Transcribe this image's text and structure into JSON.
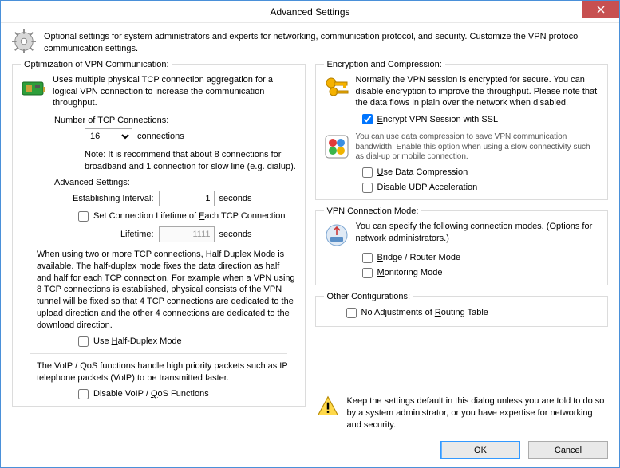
{
  "window": {
    "title": "Advanced Settings"
  },
  "intro": {
    "text": "Optional settings for system administrators and experts for networking, communication protocol, and security. Customize the VPN protocol communication settings."
  },
  "opt": {
    "legend": "Optimization of VPN Communication:",
    "desc": "Uses multiple physical TCP connection aggregation for a logical VPN connection to increase the communication throughput.",
    "numLabel_pre": "N",
    "numLabel_rest": "umber of TCP Connections:",
    "connValue": "16",
    "connSuffix": "connections",
    "note": "Note: It is recommend that about 8 connections for broadband and 1 connection for slow line (e.g. dialup).",
    "advLabel": "Advanced Settings:",
    "estLabel": "Establishing Interval:",
    "estValue": "1",
    "estSuffix": "seconds",
    "lifetimeChk_pre": "Set Connection Lifetime of ",
    "lifetimeChk_u": "E",
    "lifetimeChk_post": "ach TCP Connection",
    "lifeLabel": "Lifetime:",
    "lifeValue": "1111",
    "lifeSuffix": "seconds",
    "halfDesc": "When using two or more TCP connections, Half Duplex Mode is available. The half-duplex mode fixes the data direction as half and half for each TCP connection. For example when a VPN using 8 TCP connections is established, physical consists of the VPN tunnel will be fixed so that 4 TCP connections are dedicated to the upload direction and the other 4 connections are dedicated to the download direction.",
    "halfChk_pre": "Use ",
    "halfChk_u": "H",
    "halfChk_post": "alf-Duplex Mode",
    "voipDesc": "The VoIP / QoS functions handle high priority packets such as IP telephone packets (VoIP) to be transmitted faster.",
    "voipChk_pre": "Disable VoIP / ",
    "voipChk_u": "Q",
    "voipChk_post": "oS Functions"
  },
  "enc": {
    "legend": "Encryption and Compression:",
    "desc": "Normally the VPN session is encrypted for secure. You can disable encryption to improve the throughput. Please note that the data flows in plain over the network when disabled.",
    "sslChk_u": "E",
    "sslChk_post": "ncrypt VPN Session with SSL",
    "sslChecked": true,
    "compDesc": "You can use data compression to save VPN communication bandwidth. Enable this option when using a slow connectivity such as dial-up or mobile connection.",
    "useCompChk_u": "U",
    "useCompChk_post": "se Data Compression",
    "disUdpChk": "Disable UDP Acceleration"
  },
  "mode": {
    "legend": "VPN Connection Mode:",
    "desc": "You can specify the following connection modes. (Options for network administrators.)",
    "bridgeChk_u": "B",
    "bridgeChk_post": "ridge / Router Mode",
    "monChk_u": "M",
    "monChk_post": "onitoring Mode"
  },
  "other": {
    "legend": "Other Configurations:",
    "routeChk_pre": "No Adjustments of ",
    "routeChk_u": "R",
    "routeChk_post": "outing Table"
  },
  "warn": {
    "text": "Keep the settings default in this dialog unless you are told to do so by a system administrator, or you have expertise for networking and security."
  },
  "buttons": {
    "ok_u": "O",
    "ok_rest": "K",
    "cancel": "Cancel"
  }
}
